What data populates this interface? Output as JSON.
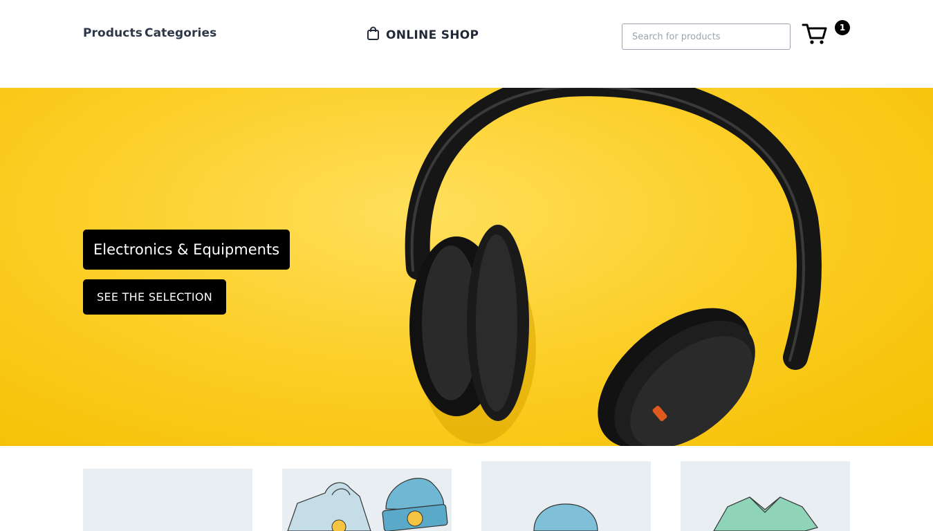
{
  "nav": {
    "products_label": "Products",
    "categories_label": "Categories"
  },
  "brand": {
    "name": "ONLINE SHOP",
    "icon": "shopping-bag-icon"
  },
  "search": {
    "placeholder": "Search for products",
    "value": ""
  },
  "cart": {
    "icon": "cart-icon",
    "count": "1"
  },
  "hero": {
    "title": "Electronics & Equipments",
    "button_label": "SEE THE SELECTION",
    "image": "headphones-on-yellow-background",
    "background_color": "#fccf2a"
  },
  "products": [
    {
      "image": "blank-product-image"
    },
    {
      "image": "hoodie-and-beanie-illustration"
    },
    {
      "image": "beanie-illustration"
    },
    {
      "image": "v-neck-tshirt-illustration"
    }
  ],
  "colors": {
    "accent": "#000000",
    "card_background": "#e8eef2"
  }
}
